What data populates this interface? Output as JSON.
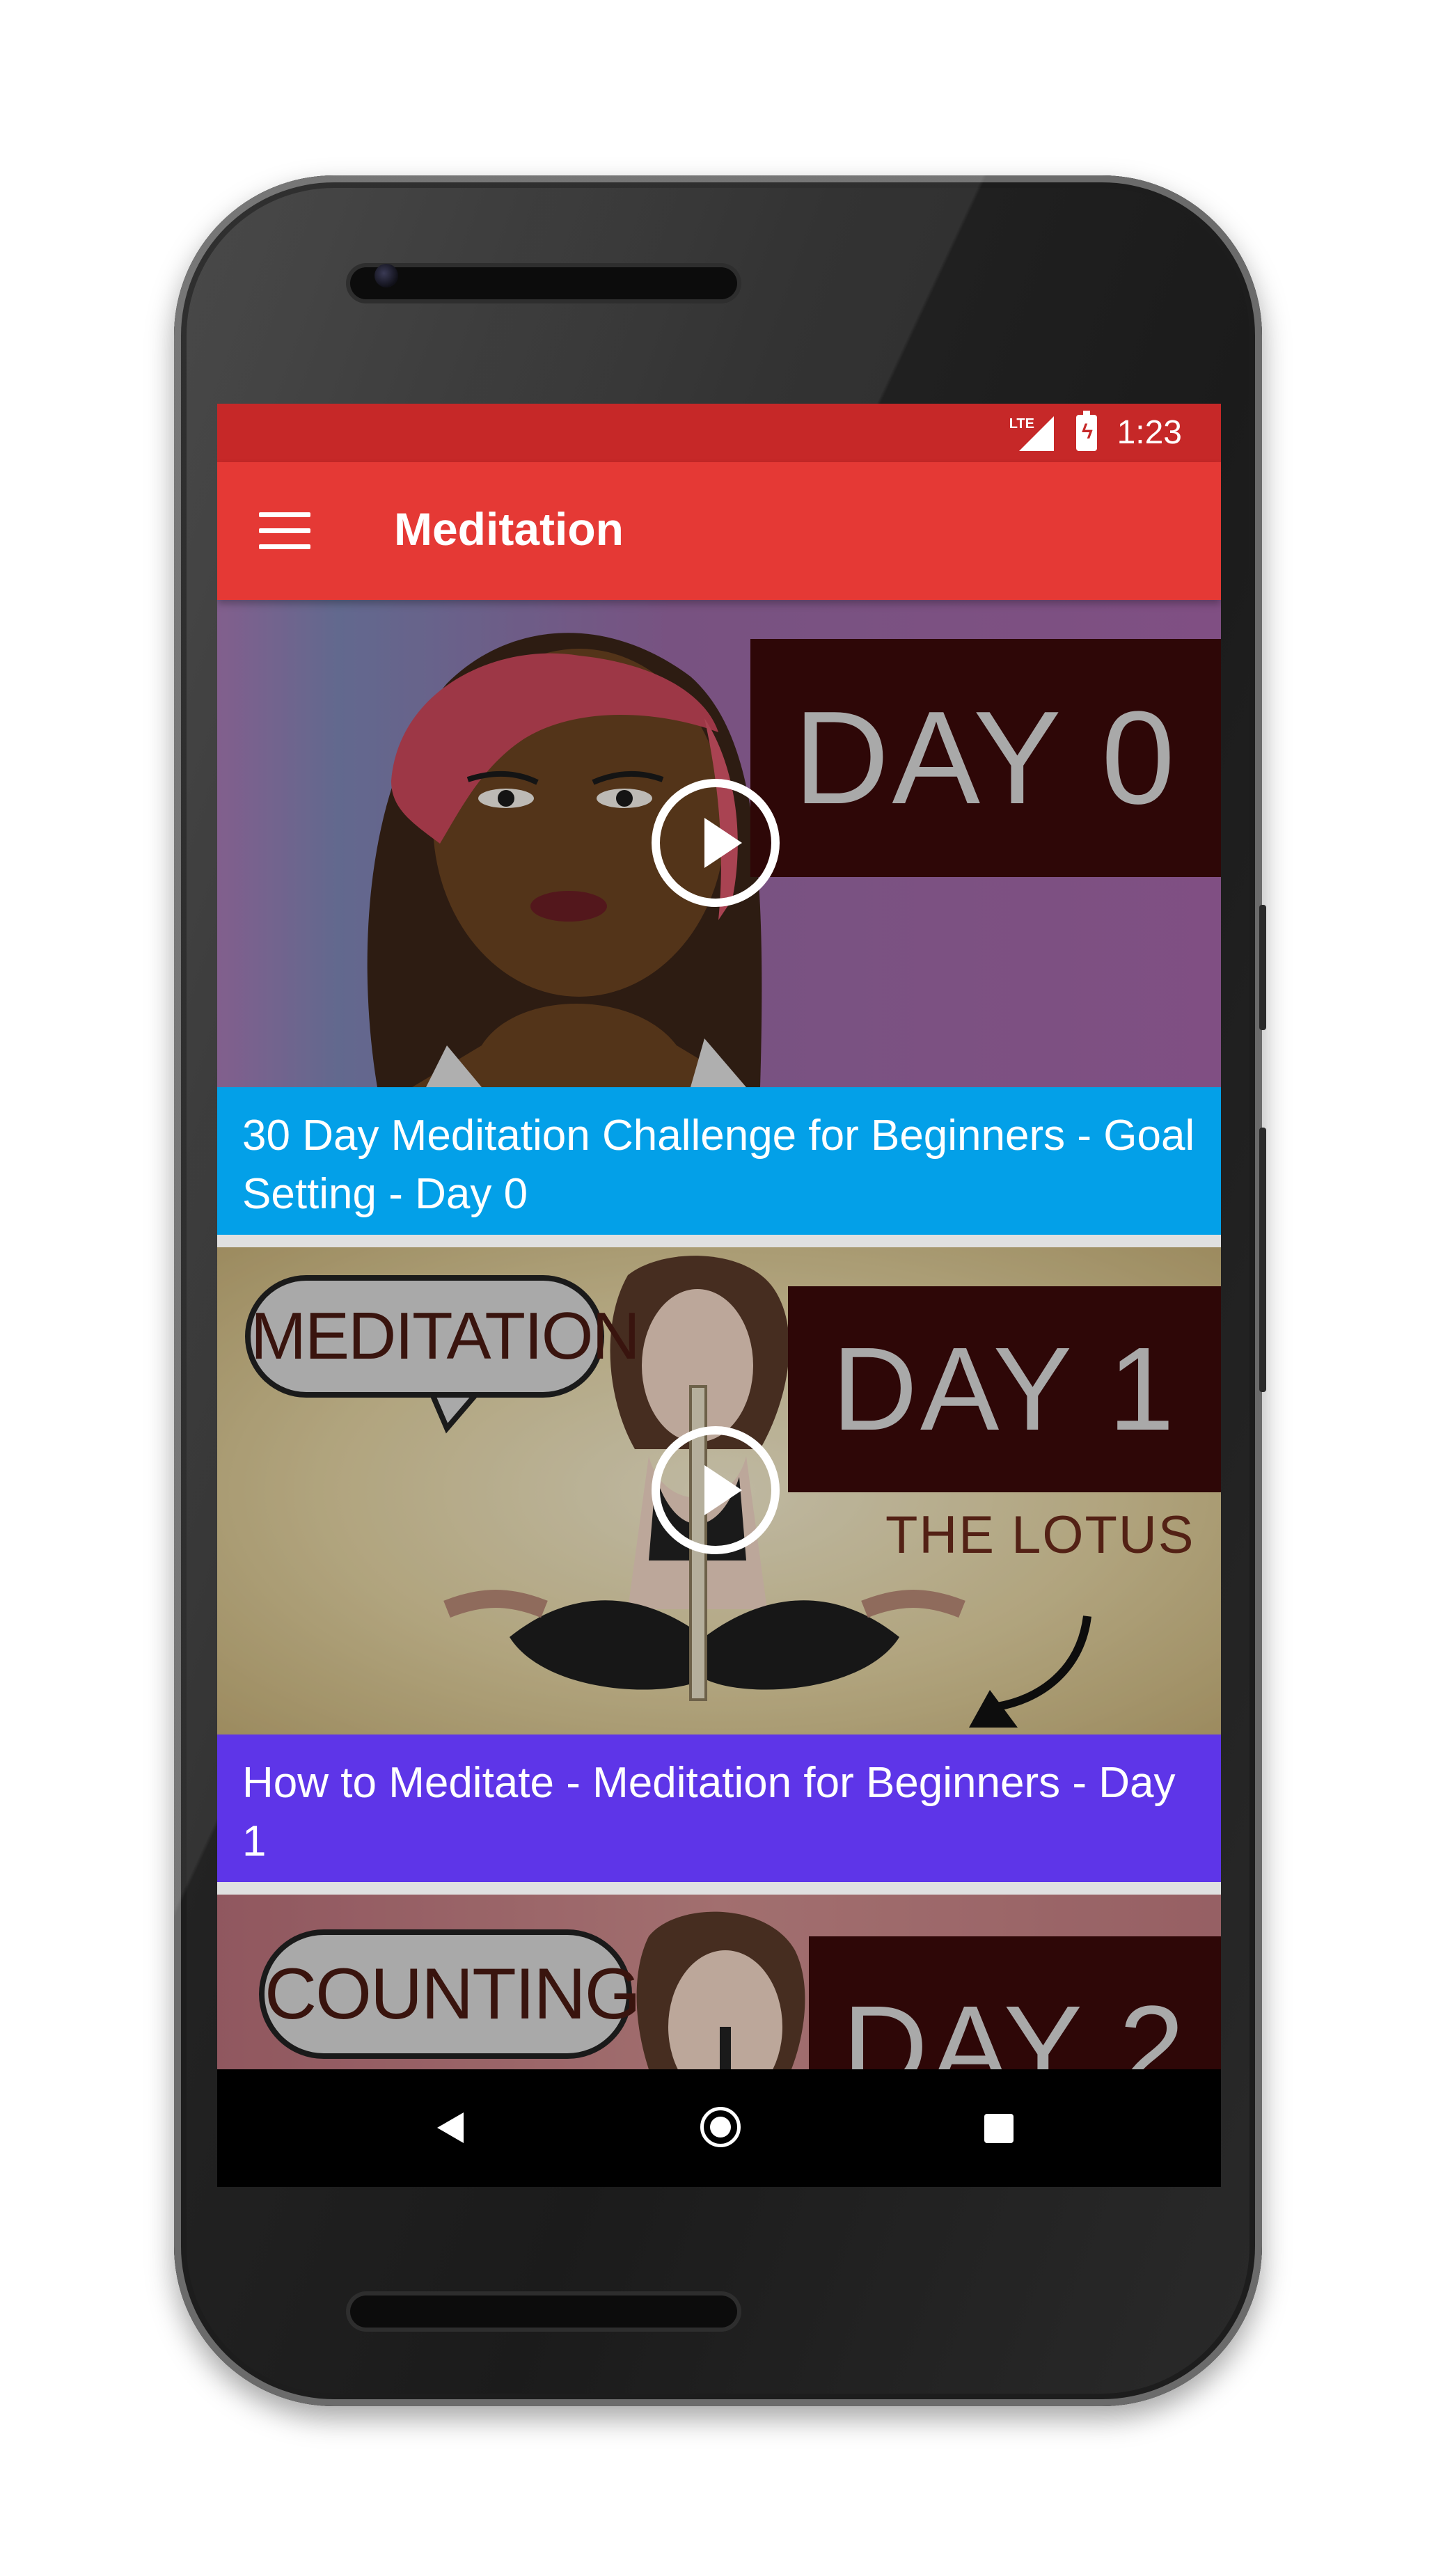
{
  "status_bar": {
    "time": "1:23",
    "network": "LTE",
    "color": "#c62828"
  },
  "app_bar": {
    "title": "Meditation",
    "color": "#e53935",
    "menu_icon": "hamburger-menu-icon"
  },
  "videos": [
    {
      "title": "30 Day Meditation Challenge for Beginners - Goal Setting - Day 0",
      "caption_color": "#03a0e8",
      "thumbnail_text": "DAY 0"
    },
    {
      "title": "How to Meditate - Meditation for Beginners - Day 1",
      "caption_color": "#5e35e8",
      "thumbnail_text": "DAY 1",
      "thumbnail_bubble": "MEDITATION",
      "thumbnail_subtext": "THE LOTUS"
    },
    {
      "thumbnail_text": "DAY 2",
      "thumbnail_bubble": "COUNTING"
    }
  ],
  "nav_bar": {
    "back_icon": "back-triangle-icon",
    "home_icon": "home-circle-icon",
    "recents_icon": "recents-square-icon"
  }
}
